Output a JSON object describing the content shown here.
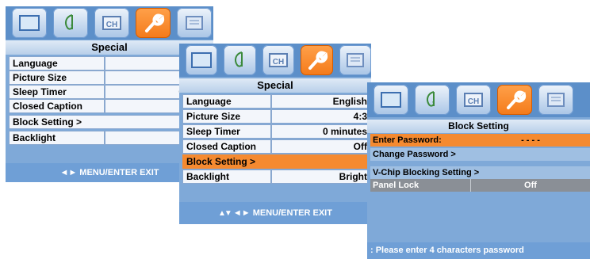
{
  "colors": {
    "panel": "#7fa9d8",
    "iconbar": "#5c8fc9",
    "accent": "#f58a30",
    "row_bg": "#f3f6fb"
  },
  "icons": [
    "picture-icon",
    "audio-icon",
    "channel-icon",
    "setup-wrench-icon",
    "lock-icon"
  ],
  "menu1": {
    "title": "Special",
    "rows": [
      {
        "label": "Language",
        "value": "Engli"
      },
      {
        "label": "Picture Size",
        "value": "4:3"
      },
      {
        "label": "Sleep Timer",
        "value": "0 minu"
      },
      {
        "label": "Closed Caption",
        "value": "Off"
      },
      {
        "label": "Block Setting  >",
        "value": ""
      },
      {
        "label": "Backlight",
        "value": "Brigh"
      }
    ],
    "footer": "◄►  MENU/ENTER EXIT"
  },
  "menu2": {
    "title": "Special",
    "rows": [
      {
        "label": "Language",
        "value": "English"
      },
      {
        "label": "Picture Size",
        "value": "4:3"
      },
      {
        "label": "Sleep Timer",
        "value": "0 minutes"
      },
      {
        "label": "Closed Caption",
        "value": "Off"
      },
      {
        "label": "Block Setting  >",
        "value": ""
      },
      {
        "label": "Backlight",
        "value": "Bright"
      }
    ],
    "footer": "◄►  MENU/ENTER EXIT"
  },
  "menu3": {
    "title": "Block Setting",
    "rows": [
      {
        "label": "Enter Password:",
        "value": "- - - -"
      },
      {
        "label": "Change Password  >",
        "value": ""
      },
      {
        "label": "V-Chip Blocking Setting  >",
        "value": ""
      },
      {
        "label": "Panel Lock",
        "value": "Off"
      }
    ],
    "footer": ": Please enter 4 characters password"
  }
}
